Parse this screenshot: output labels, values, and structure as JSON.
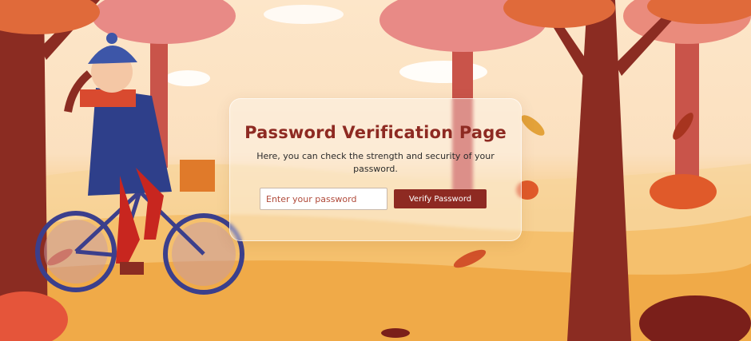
{
  "page": {
    "title": "Password Verification Page",
    "subtitle": "Here, you can check the strength and security of your password."
  },
  "form": {
    "password_placeholder": "Enter your password",
    "password_value": "",
    "verify_label": "Verify Password"
  },
  "colors": {
    "accent": "#8e2a22",
    "sky": "#fde6c9",
    "ground": "#f2b35a",
    "trunk": "#8b2c22",
    "foliage": "#e07a5f"
  },
  "illustration": {
    "theme": "autumn-cyclist"
  }
}
